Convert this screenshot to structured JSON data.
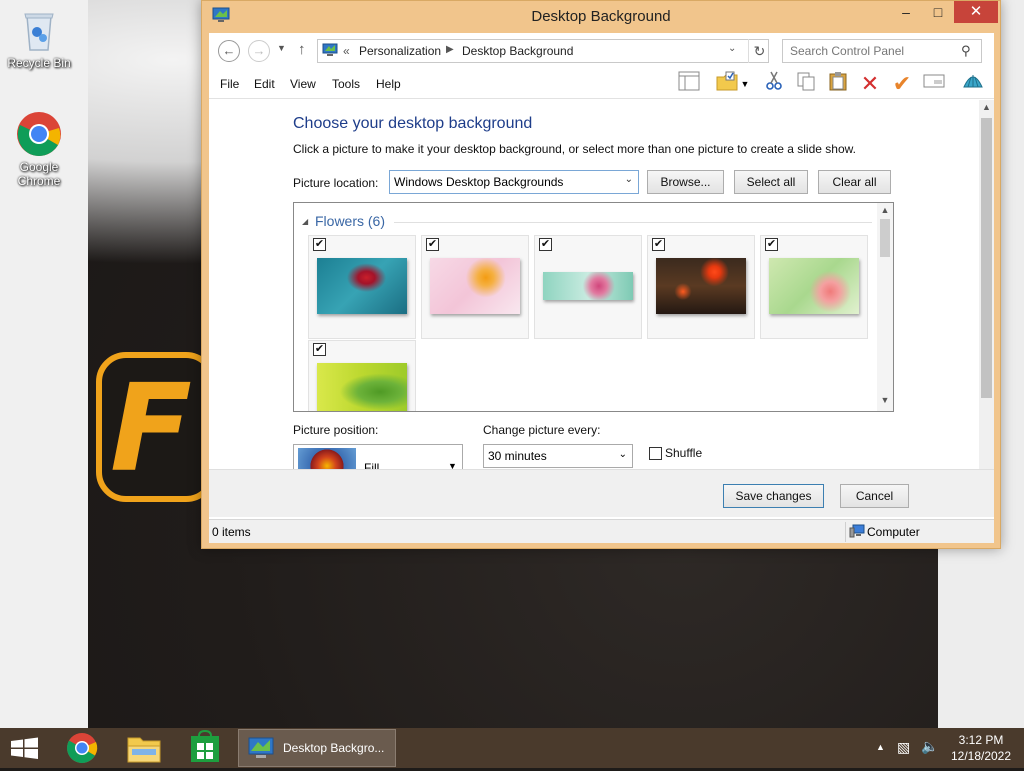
{
  "desktop": {
    "icons": [
      {
        "label_line1": "Recycle Bin",
        "label_line2": ""
      },
      {
        "label_line1": "Google",
        "label_line2": "Chrome"
      }
    ]
  },
  "window": {
    "title": "Desktop Background",
    "address": {
      "crumbs": [
        "Personalization",
        "Desktop Background"
      ],
      "search_placeholder": "Search Control Panel"
    },
    "menu": [
      "File",
      "Edit",
      "View",
      "Tools",
      "Help"
    ],
    "content": {
      "heading": "Choose your desktop background",
      "subtext": "Click a picture to make it your desktop background, or select more than one picture to create a slide show.",
      "location_label": "Picture location:",
      "location_value": "Windows Desktop Backgrounds",
      "browse_label": "Browse...",
      "select_all_label": "Select all",
      "clear_all_label": "Clear all",
      "group_title": "Flowers (6)",
      "images_checked": [
        true,
        true,
        true,
        true,
        true,
        true
      ],
      "position_label": "Picture position:",
      "position_value": "Fill",
      "change_label": "Change picture every:",
      "interval_value": "30 minutes",
      "shuffle_label": "Shuffle",
      "shuffle_checked": false
    },
    "buttons": {
      "save": "Save changes",
      "cancel": "Cancel"
    },
    "status": {
      "items": "0 items",
      "location": "Computer"
    }
  },
  "taskbar": {
    "active_task": "Desktop Backgro...",
    "time": "3:12 PM",
    "date": "12/18/2022"
  },
  "colors": {
    "window_frame": "#f1c58c",
    "close_button": "#c7443a",
    "heading": "#1e3d8a",
    "taskbar": "#4a3a2c"
  }
}
